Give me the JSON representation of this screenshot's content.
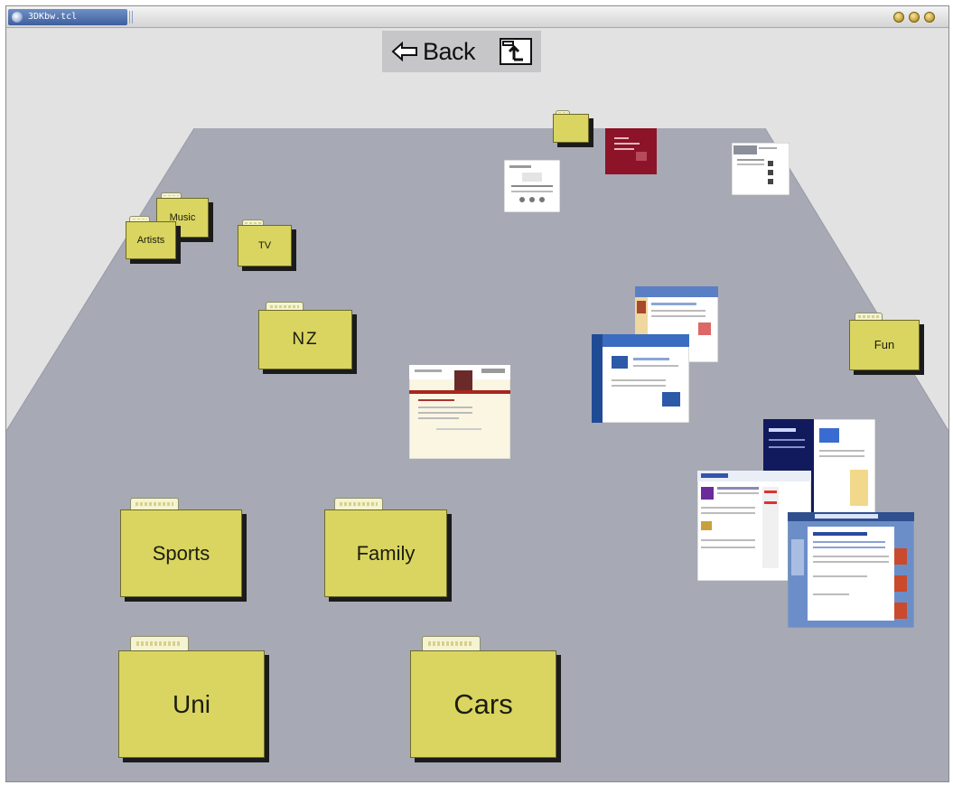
{
  "window": {
    "title": "3DKbw.tcl",
    "buttons": [
      "minimize",
      "maximize",
      "close"
    ]
  },
  "navigation": {
    "back_label": "Back",
    "back_icon": "arrow-left-icon",
    "up_icon": "folder-up-icon"
  },
  "folders": [
    {
      "id": "music",
      "label": "Music"
    },
    {
      "id": "artists",
      "label": "Artists"
    },
    {
      "id": "tv",
      "label": "TV"
    },
    {
      "id": "nz",
      "label": "NZ"
    },
    {
      "id": "fun",
      "label": "Fun"
    },
    {
      "id": "sports",
      "label": "Sports"
    },
    {
      "id": "family",
      "label": "Family"
    },
    {
      "id": "uni",
      "label": "Uni"
    },
    {
      "id": "cars",
      "label": "Cars"
    },
    {
      "id": "unnamed",
      "label": ""
    }
  ],
  "webpages": [
    {
      "id": "page-white-back"
    },
    {
      "id": "page-maroon"
    },
    {
      "id": "page-white-right"
    },
    {
      "id": "page-center"
    },
    {
      "id": "page-blue-1"
    },
    {
      "id": "page-blue-2"
    },
    {
      "id": "page-stack-navy"
    },
    {
      "id": "page-stack-news"
    },
    {
      "id": "page-stack-blue"
    }
  ],
  "colors": {
    "folder": "#d9d560",
    "floor": "#a7a9b4",
    "wall": "#e2e2e2",
    "titlebar_accent": "#3d5f9c"
  }
}
